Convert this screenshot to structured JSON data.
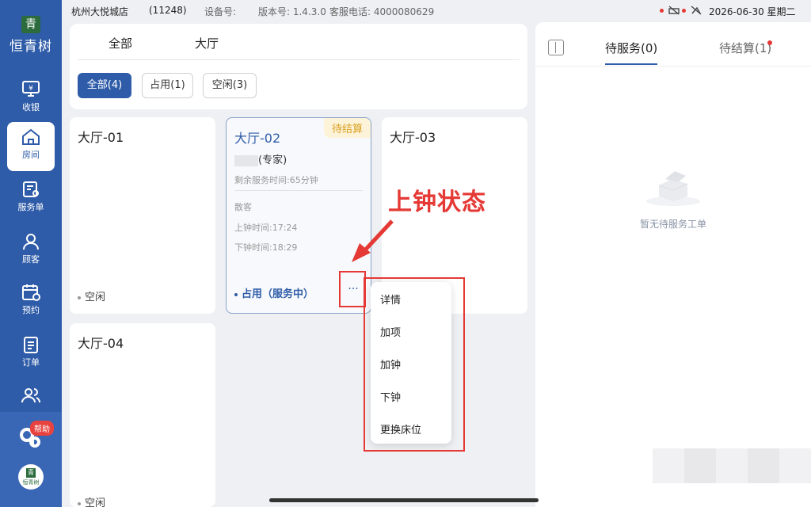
{
  "brand": {
    "name": "恒青树",
    "logo_char": "青"
  },
  "nav": [
    {
      "label": "收银",
      "icon": "cashier-icon"
    },
    {
      "label": "房间",
      "icon": "home-icon",
      "active": true
    },
    {
      "label": "服务单",
      "icon": "service-order-icon"
    },
    {
      "label": "顾客",
      "icon": "customer-icon"
    },
    {
      "label": "预约",
      "icon": "calendar-icon"
    },
    {
      "label": "订单",
      "icon": "order-icon"
    },
    {
      "label": "",
      "icon": "staff-icon"
    }
  ],
  "help_label": "帮助",
  "avatar_text": "恒青树",
  "status_bar": {
    "store": "杭州大悦城店",
    "store_code": "(11248)",
    "device": "设备号:",
    "version": "版本号: 1.4.3.0",
    "hotline": "客服电话: 4000080629",
    "datetime": "2026-06-30 星期二"
  },
  "area_tabs": [
    "全部",
    "大厅"
  ],
  "filters": [
    {
      "label": "全部(4)",
      "active": true
    },
    {
      "label": "占用(1)"
    },
    {
      "label": "空闲(3)"
    }
  ],
  "rooms": {
    "r1": {
      "name": "大厅-01",
      "status": "空闲"
    },
    "r2": {
      "name": "大厅-02",
      "tag": "待结算",
      "customer_suffix": "(专家)",
      "remaining": "剩余服务时间:65分钟",
      "customer_type": "散客",
      "start": "上钟时间:17:24",
      "end": "下钟时间:18:29",
      "status": "占用（服务中）",
      "more": "···"
    },
    "r3": {
      "name": "大厅-03"
    },
    "r4": {
      "name": "大厅-04",
      "status": "空闲"
    }
  },
  "menu": [
    "详情",
    "加项",
    "加钟",
    "下钟",
    "更换床位"
  ],
  "annotation": "上钟状态",
  "right_panel": {
    "tabs": [
      "待服务(0)",
      "待结算(1)"
    ],
    "empty_text": "暂无待服务工单"
  },
  "colors": {
    "primary": "#2f5ca8",
    "annotation": "#e53935",
    "pending": "#d8a020"
  }
}
